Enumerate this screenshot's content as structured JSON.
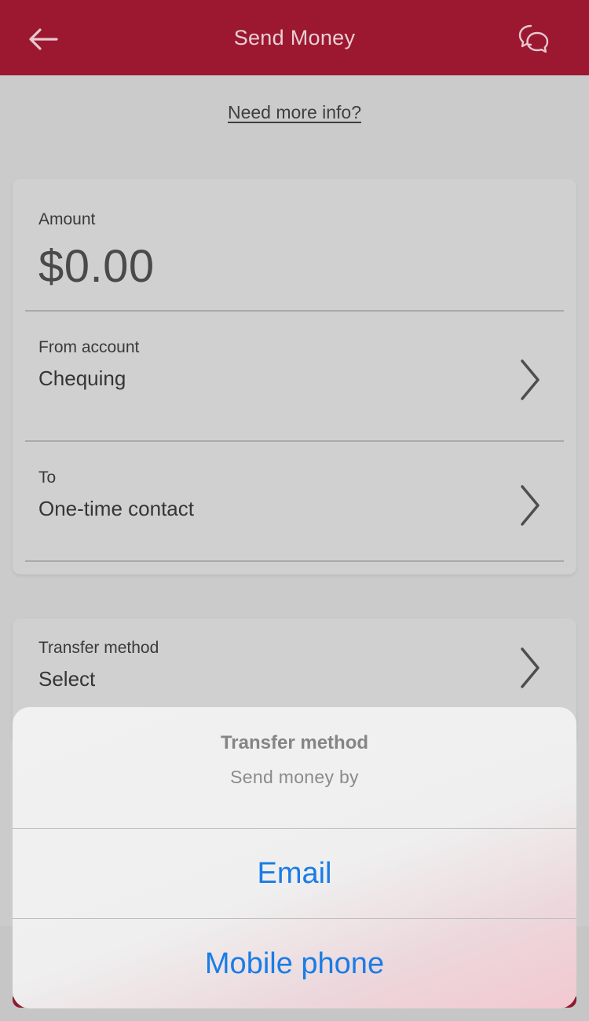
{
  "header": {
    "title": "Send Money",
    "back_icon": "arrow-left-icon",
    "chat_icon": "chat-bubbles-icon",
    "background_color": "#9c1830"
  },
  "info_link": "Need more info?",
  "form": {
    "amount": {
      "label": "Amount",
      "value": "$0.00"
    },
    "from_account": {
      "label": "From account",
      "value": "Chequing"
    },
    "to": {
      "label": "To",
      "value": "One-time contact"
    },
    "transfer_method": {
      "label": "Transfer method",
      "value": "Select"
    }
  },
  "action_sheet": {
    "title": "Transfer method",
    "subtitle": "Send money by",
    "options": [
      "Email",
      "Mobile phone"
    ],
    "option_color": "#1a7ce6"
  }
}
